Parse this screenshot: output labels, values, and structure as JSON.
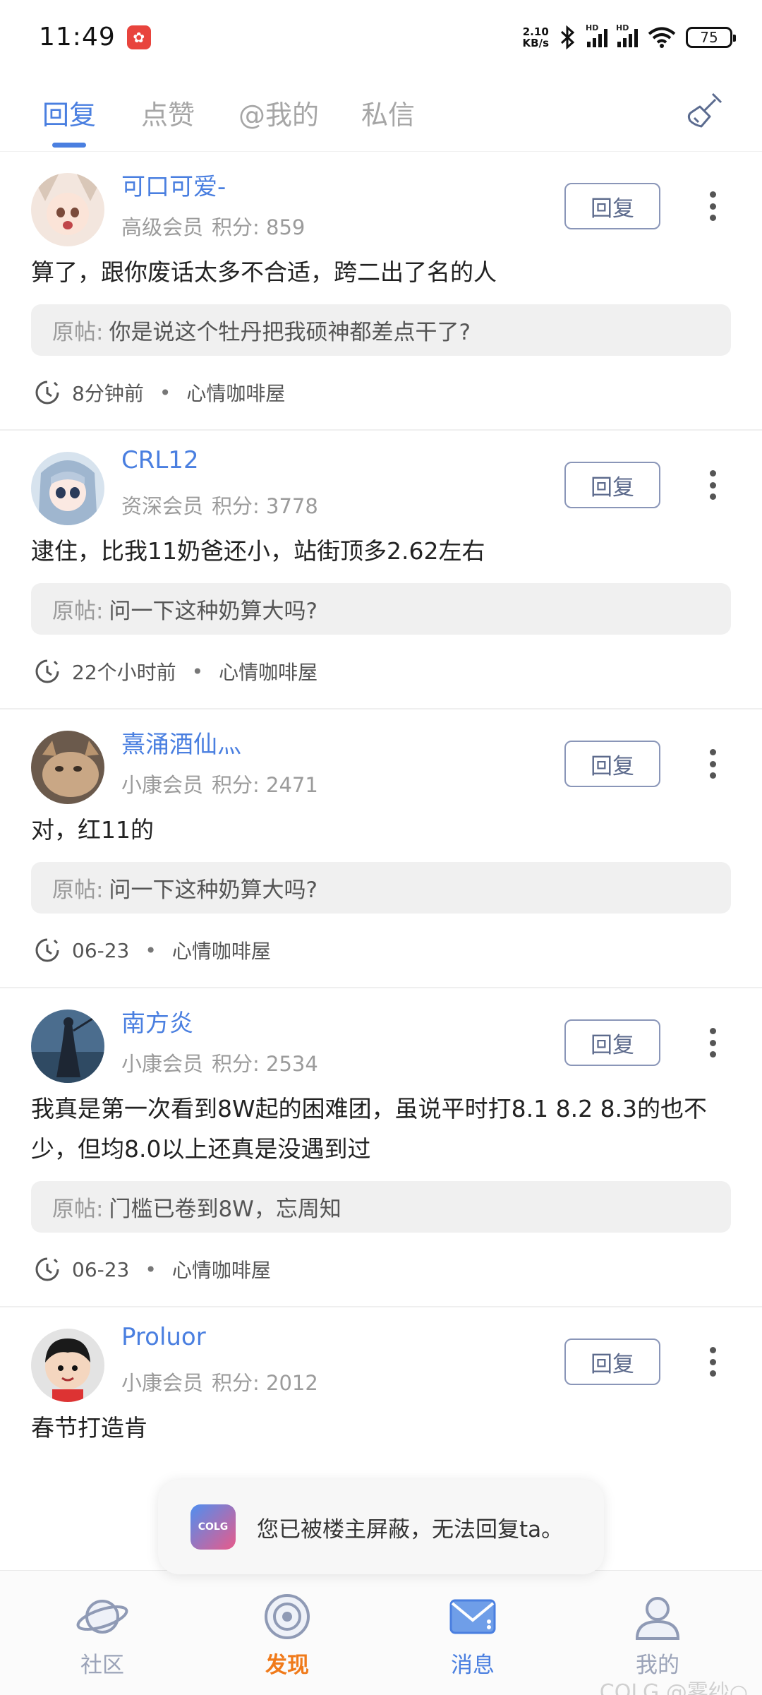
{
  "status_bar": {
    "time": "11:49",
    "net_speed_value": "2.10",
    "net_speed_unit": "KB/s",
    "battery": "75"
  },
  "tabs": [
    {
      "label": "回复",
      "active": true
    },
    {
      "label": "点赞",
      "active": false
    },
    {
      "label": "@我的",
      "active": false
    },
    {
      "label": "私信",
      "active": false
    }
  ],
  "reply_button_label": "回复",
  "original_label": "原帖:",
  "items": [
    {
      "name": "可口可爱-",
      "level": "高级会员",
      "points": "积分: 859",
      "content": "算了，跟你废话太多不合适，跨二出了名的人",
      "original": "你是说这个牡丹把我硕神都差点干了?",
      "time": "8分钟前",
      "board": "心情咖啡屋"
    },
    {
      "name": "CRL12",
      "level": "资深会员",
      "points": "积分: 3778",
      "content": "逮住，比我11奶爸还小，站街顶多2.62左右",
      "original": "问一下这种奶算大吗?",
      "time": "22个小时前",
      "board": "心情咖啡屋"
    },
    {
      "name": "熹涌酒仙灬",
      "level": "小康会员",
      "points": "积分: 2471",
      "content": "对，红11的",
      "original": "问一下这种奶算大吗?",
      "time": "06-23",
      "board": "心情咖啡屋"
    },
    {
      "name": "南方炎",
      "level": "小康会员",
      "points": "积分: 2534",
      "content": "我真是第一次看到8W起的困难团，虽说平时打8.1 8.2 8.3的也不少，但均8.0以上还真是没遇到过",
      "original": "门槛已卷到8W，忘周知",
      "time": "06-23",
      "board": "心情咖啡屋"
    },
    {
      "name": "Proluor",
      "level": "小康会员",
      "points": "积分: 2012",
      "content": "春节打造肯"
    }
  ],
  "toast": {
    "logo_text": "COLG",
    "text": "您已被楼主屏蔽，无法回复ta。"
  },
  "bottom_nav": [
    {
      "label": "社区",
      "icon": "planet-icon"
    },
    {
      "label": "发现",
      "icon": "radar-icon"
    },
    {
      "label": "消息",
      "icon": "mail-icon"
    },
    {
      "label": "我的",
      "icon": "user-icon"
    }
  ],
  "watermark": "COLG @雾纱○",
  "colors": {
    "accent_blue": "#4a7fe0",
    "discover_orange": "#f07a1a",
    "muted_gray": "#9b9b9b"
  }
}
